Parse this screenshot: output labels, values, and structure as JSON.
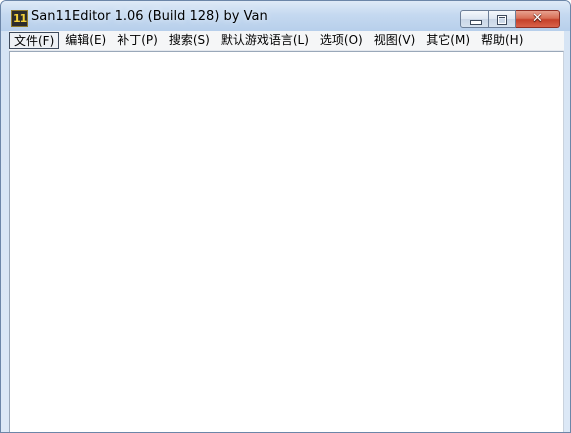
{
  "window": {
    "title": "San11Editor 1.06 (Build 128) by Van",
    "icon_label": "11",
    "controls": {
      "minimize": "minimize",
      "maximize": "maximize",
      "close": "✕"
    }
  },
  "menu": {
    "items": [
      {
        "label": "文件(F)"
      },
      {
        "label": "编辑(E)"
      },
      {
        "label": "补丁(P)"
      },
      {
        "label": "搜索(S)"
      },
      {
        "label": "默认游戏语言(L)"
      },
      {
        "label": "选项(O)"
      },
      {
        "label": "视图(V)"
      },
      {
        "label": "其它(M)"
      },
      {
        "label": "帮助(H)"
      }
    ]
  },
  "colors": {
    "titlebar": "#c5d9f0",
    "close_button": "#c5402a",
    "menubar": "#f5f6f7",
    "client_area": "#ffffff"
  }
}
